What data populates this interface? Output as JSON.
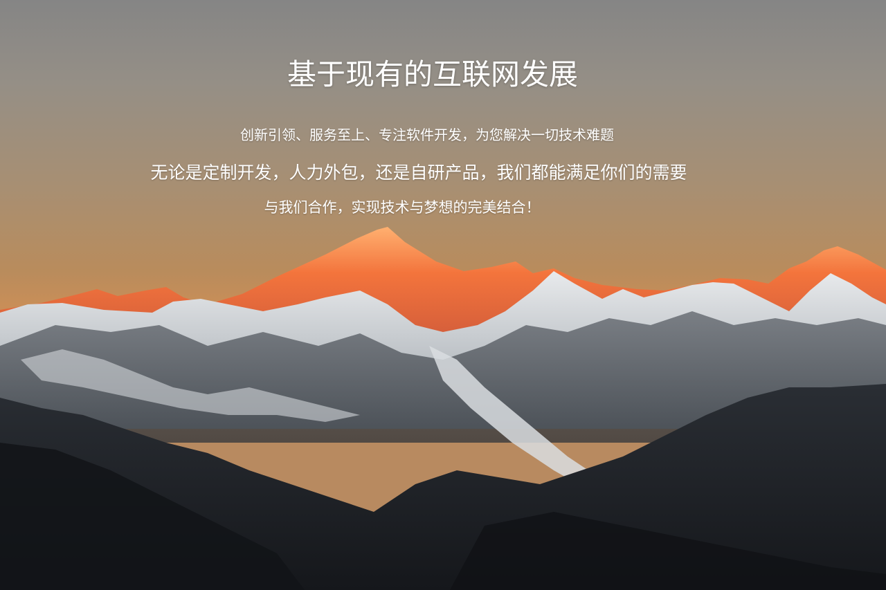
{
  "hero": {
    "title": "基于现有的互联网发展",
    "tagline": "创新引领、服务至上、专注软件开发，为您解决一切技术难题",
    "services": "无论是定制开发，人力外包，还是自研产品，我们都能满足你们的需要",
    "cta": "与我们合作，实现技术与梦想的完美结合！",
    "background_image": "snow-capped-mountain-range-at-sunset",
    "colors": {
      "sky_top": "#858585",
      "sky_glow": "#c98e58",
      "peak_glow": "#f3743c",
      "snow": "#e9ecee",
      "foreground": "#1b1e23",
      "text": "#ffffff"
    }
  }
}
